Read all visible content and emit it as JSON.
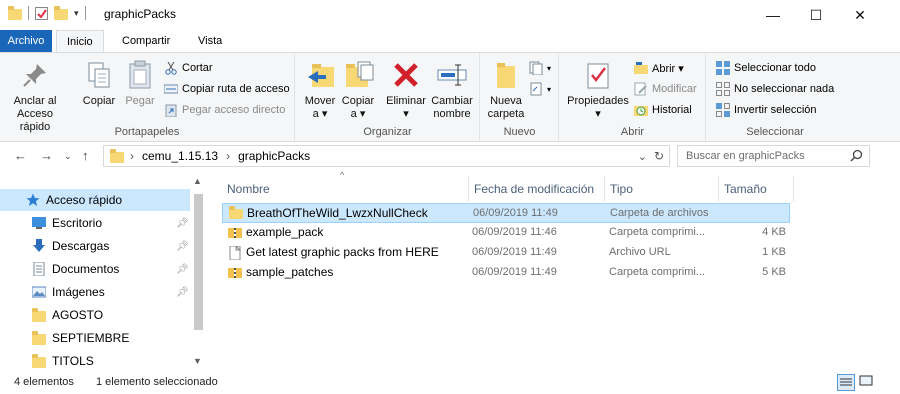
{
  "window": {
    "title": "graphicPacks",
    "controls": {
      "minimize": "—",
      "maximize": "☐",
      "close": "✕"
    }
  },
  "ribbon_tabs": [
    "Archivo",
    "Inicio",
    "Compartir",
    "Vista"
  ],
  "ribbon": {
    "clipboard": {
      "label": "Portapapeles",
      "pin": "Anclar al\nAcceso rápido",
      "copy": "Copiar",
      "paste": "Pegar",
      "cut": "Cortar",
      "copy_path": "Copiar ruta de acceso",
      "paste_shortcut": "Pegar acceso directo"
    },
    "organize": {
      "label": "Organizar",
      "move_to": "Mover\na ▾",
      "copy_to": "Copiar\na ▾",
      "delete": "Eliminar\n▾",
      "rename": "Cambiar\nnombre"
    },
    "new": {
      "label": "Nuevo",
      "new_folder": "Nueva\ncarpeta"
    },
    "open": {
      "label": "Abrir",
      "properties": "Propiedades\n▾",
      "open": "Abrir ▾",
      "edit": "Modificar",
      "history": "Historial"
    },
    "select": {
      "label": "Seleccionar",
      "select_all": "Seleccionar todo",
      "select_none": "No seleccionar nada",
      "invert": "Invertir selección"
    }
  },
  "address": {
    "breadcrumbs": [
      "cemu_1.15.13",
      "graphicPacks"
    ],
    "search_placeholder": "Buscar en graphicPacks"
  },
  "nav_pane": {
    "items": [
      {
        "label": "Acceso rápido",
        "icon": "star-icon",
        "pinned": false
      },
      {
        "label": "Escritorio",
        "icon": "desktop-icon",
        "pinned": true
      },
      {
        "label": "Descargas",
        "icon": "download-icon",
        "pinned": true
      },
      {
        "label": "Documentos",
        "icon": "documents-icon",
        "pinned": true
      },
      {
        "label": "Imágenes",
        "icon": "pictures-icon",
        "pinned": true
      },
      {
        "label": "AGOSTO",
        "icon": "folder-icon",
        "pinned": false
      },
      {
        "label": "SEPTIEMBRE",
        "icon": "folder-icon",
        "pinned": false
      },
      {
        "label": "TITOLS",
        "icon": "folder-icon",
        "pinned": false
      }
    ]
  },
  "file_list": {
    "columns": [
      "Nombre",
      "Fecha de modificación",
      "Tipo",
      "Tamaño"
    ],
    "rows": [
      {
        "name": "BreathOfTheWild_LwzxNullCheck",
        "date": "06/09/2019 11:49",
        "type": "Carpeta de archivos",
        "size": "",
        "icon": "folder-icon",
        "selected": true
      },
      {
        "name": "example_pack",
        "date": "06/09/2019 11:46",
        "type": "Carpeta comprimi...",
        "size": "4 KB",
        "icon": "zip-folder-icon",
        "selected": false
      },
      {
        "name": "Get latest graphic packs from HERE",
        "date": "06/09/2019 11:49",
        "type": "Archivo URL",
        "size": "1 KB",
        "icon": "url-file-icon",
        "selected": false
      },
      {
        "name": "sample_patches",
        "date": "06/09/2019 11:49",
        "type": "Carpeta comprimi...",
        "size": "5 KB",
        "icon": "zip-folder-icon",
        "selected": false
      }
    ]
  },
  "status": {
    "count": "4 elementos",
    "selection": "1 elemento seleccionado"
  },
  "colors": {
    "accent": "#1a66b8",
    "selection": "#cce8ff",
    "folder": "#f8d775"
  }
}
